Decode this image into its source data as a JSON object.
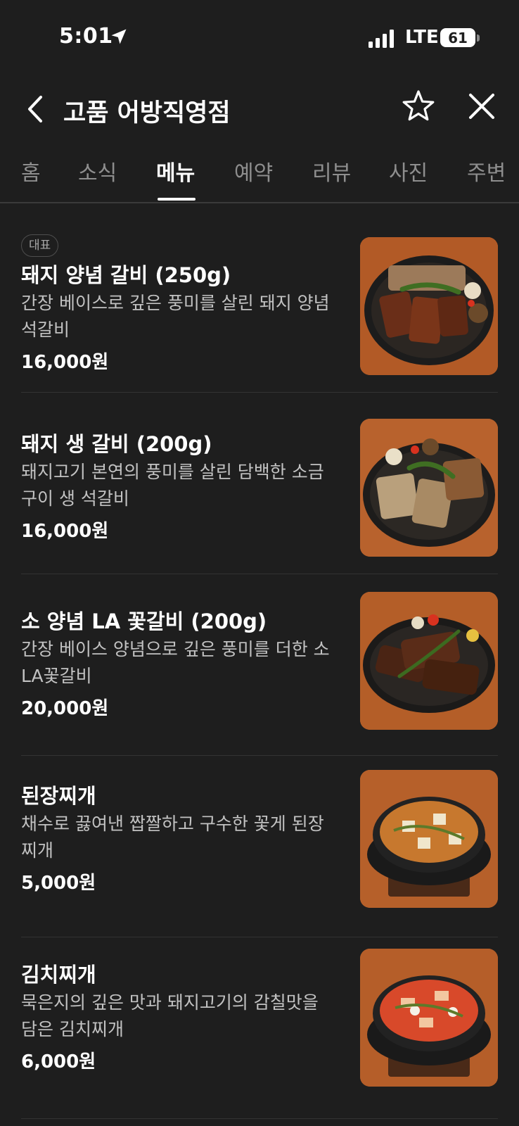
{
  "status_bar": {
    "time": "5:01",
    "network": "LTE",
    "battery": "61",
    "icons": [
      "location-arrow-icon",
      "signal-bars-icon",
      "battery-icon"
    ]
  },
  "header": {
    "title": "고품 어방직영점",
    "icons": [
      "chevron-left-icon",
      "star-outline-icon",
      "close-icon"
    ]
  },
  "tabs": [
    {
      "label": "홈",
      "active": false
    },
    {
      "label": "소식",
      "active": false
    },
    {
      "label": "메뉴",
      "active": true
    },
    {
      "label": "예약",
      "active": false
    },
    {
      "label": "리뷰",
      "active": false
    },
    {
      "label": "사진",
      "active": false
    },
    {
      "label": "주변",
      "active": false
    }
  ],
  "menu": {
    "items": [
      {
        "badge": "대표",
        "name": "돼지 양념 갈비 (250g)",
        "description": "간장 베이스로 깊은 풍미를 살린 돼지 양념 석갈비",
        "price": "16,000원",
        "image": "grilled-pork-ribs-plate"
      },
      {
        "name": "돼지 생 갈비 (200g)",
        "description": "돼지고기 본연의 풍미를 살린 담백한 소금 구이 생 석갈비",
        "price": "16,000원",
        "image": "salt-grilled-pork-ribs-plate"
      },
      {
        "name": "소 양념 LA 꽃갈비 (200g)",
        "description": "간장 베이스 양념으로 깊은 풍미를 더한 소 LA꽃갈비",
        "price": "20,000원",
        "image": "beef-la-galbi-plate"
      },
      {
        "name": "된장찌개",
        "description": "채수로 끓여낸 짭짤하고 구수한 꽃게 된장 찌개",
        "price": "5,000원",
        "image": "doenjang-stew-pot"
      },
      {
        "name": "김치찌개",
        "description": "묵은지의 깊은 맛과 돼지고기의 감칠맛을 담은 김치찌개",
        "price": "6,000원",
        "image": "kimchi-stew-pot"
      }
    ]
  },
  "colors": {
    "background": "#1e1e1e",
    "text_primary": "#ffffff",
    "text_secondary": "#c2c2c2",
    "tab_inactive": "#8e8e8e",
    "divider": "#333333"
  }
}
